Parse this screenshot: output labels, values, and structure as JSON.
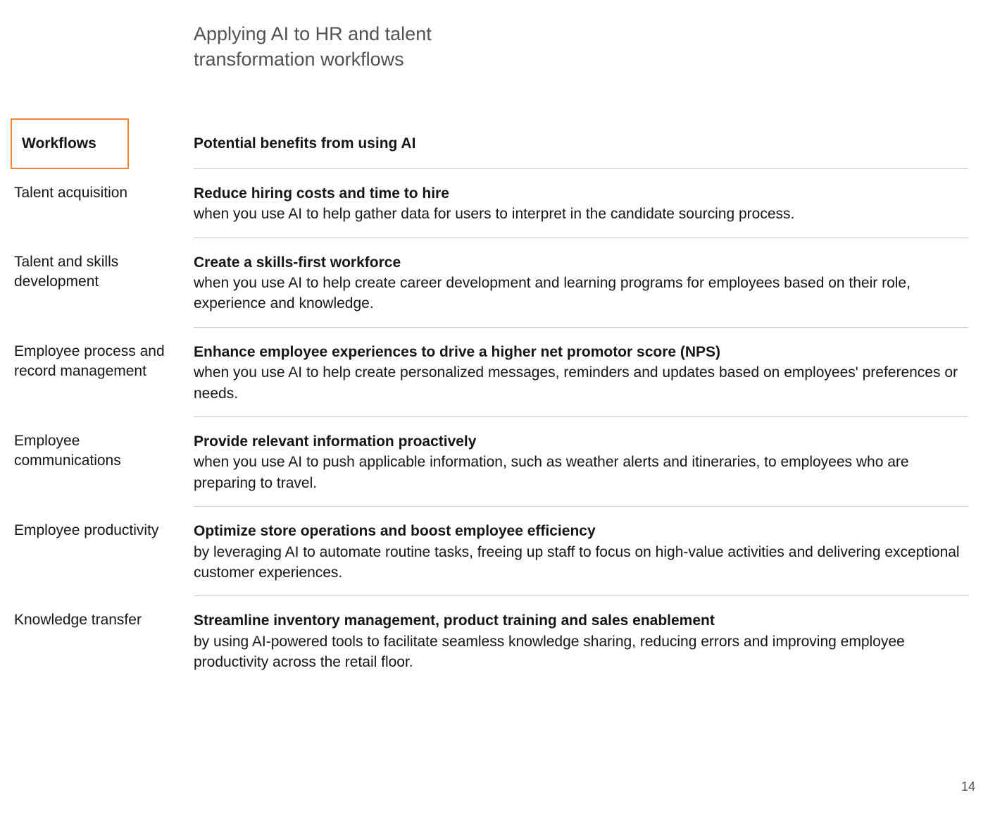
{
  "title": "Applying AI to HR and talent transformation workflows",
  "headers": {
    "workflows": "Workflows",
    "benefits": "Potential benefits from using AI"
  },
  "rows": [
    {
      "workflow": "Talent acquisition",
      "benefit_bold": "Reduce hiring costs and time to hire",
      "benefit_text": "when you use AI to help gather data for users to interpret in the candidate sourcing process."
    },
    {
      "workflow": "Talent and skills development",
      "benefit_bold": "Create a skills-first workforce",
      "benefit_text": "when you use AI to help create career development and learning programs for employees based on their role, experience and knowledge."
    },
    {
      "workflow": "Employee process and record management",
      "benefit_bold": "Enhance employee experiences to drive a higher net promotor score (NPS)",
      "benefit_text": "when you use AI to help create personalized messages, reminders and updates based on employees' preferences or needs."
    },
    {
      "workflow": "Employee communications",
      "benefit_bold": "Provide relevant information proactively",
      "benefit_text": "when you use AI to push applicable information, such as weather alerts and itineraries, to employees who are preparing to travel."
    },
    {
      "workflow": "Employee productivity",
      "benefit_bold": "Optimize store operations and boost employee efficiency",
      "benefit_text": "by leveraging AI to automate routine tasks, freeing up staff to focus on high-value activities and delivering exceptional customer experiences."
    },
    {
      "workflow": "Knowledge transfer",
      "benefit_bold": "Streamline inventory management, product training and sales enablement",
      "benefit_text": "by using AI-powered tools to facilitate seamless knowledge sharing, reducing errors and improving employee productivity across the retail floor."
    }
  ],
  "page_number": "14"
}
